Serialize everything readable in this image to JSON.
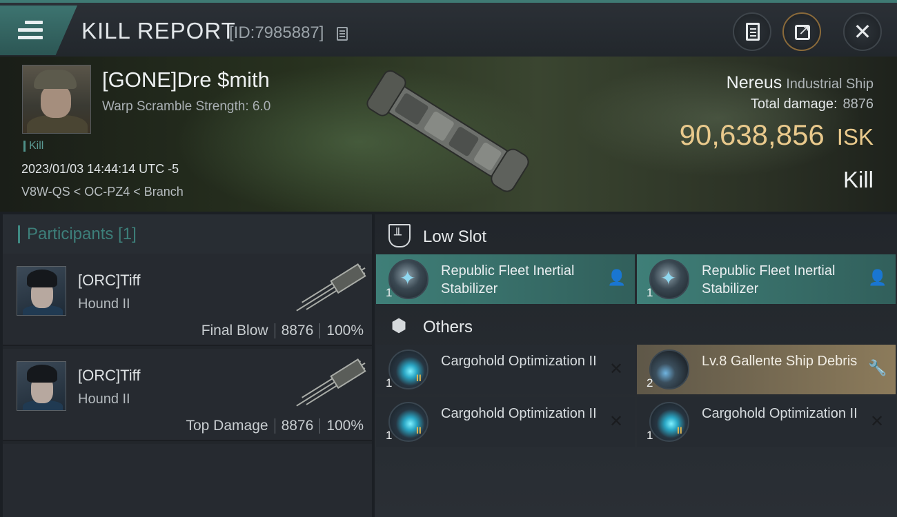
{
  "header": {
    "title": "KILL REPORT",
    "report_id": "[ID:7985887]"
  },
  "victim": {
    "name": "[GONE]Dre $mith",
    "warp_scramble": "Warp Scramble Strength: 6.0",
    "tag": "Kill",
    "datetime": "2023/01/03 14:44:14 UTC -5",
    "location": "V8W-QS < OC-PZ4 < Branch",
    "ship_name": "Nereus",
    "ship_class": "Industrial Ship",
    "total_damage_label": "Total damage:",
    "total_damage": "8876",
    "isk_value": "90,638,856",
    "isk_unit": "ISK",
    "result": "Kill"
  },
  "participants": {
    "title": "Participants [1]",
    "rows": [
      {
        "name": "[ORC]Tiff",
        "ship": "Hound II",
        "role": "Final Blow",
        "damage": "8876",
        "percent": "100%"
      },
      {
        "name": "[ORC]Tiff",
        "ship": "Hound II",
        "role": "Top Damage",
        "damage": "8876",
        "percent": "100%"
      }
    ]
  },
  "sections": {
    "low_slot": "Low Slot",
    "others": "Others"
  },
  "low_slot_items": [
    {
      "qty": "1",
      "name": "Republic Fleet Inertial Stabilizer",
      "badge": "person-icon"
    },
    {
      "qty": "1",
      "name": "Republic Fleet Inertial Stabilizer",
      "badge": "person-icon"
    }
  ],
  "other_items": [
    {
      "qty": "1",
      "meta": "II",
      "name": "Cargohold Optimization II",
      "badge": "destroyed-x-icon"
    },
    {
      "qty": "2",
      "name": "Lv.8 Gallente Ship Debris",
      "badge": "wrench-icon"
    },
    {
      "qty": "1",
      "meta": "II",
      "name": "Cargohold Optimization II",
      "badge": "destroyed-x-icon"
    },
    {
      "qty": "1",
      "meta": "II",
      "name": "Cargohold Optimization II",
      "badge": "destroyed-x-icon"
    }
  ],
  "colors": {
    "accent_teal": "#3f7f78",
    "isk_gold": "#e9c98c",
    "loot_tan": "#8c7b5b"
  }
}
